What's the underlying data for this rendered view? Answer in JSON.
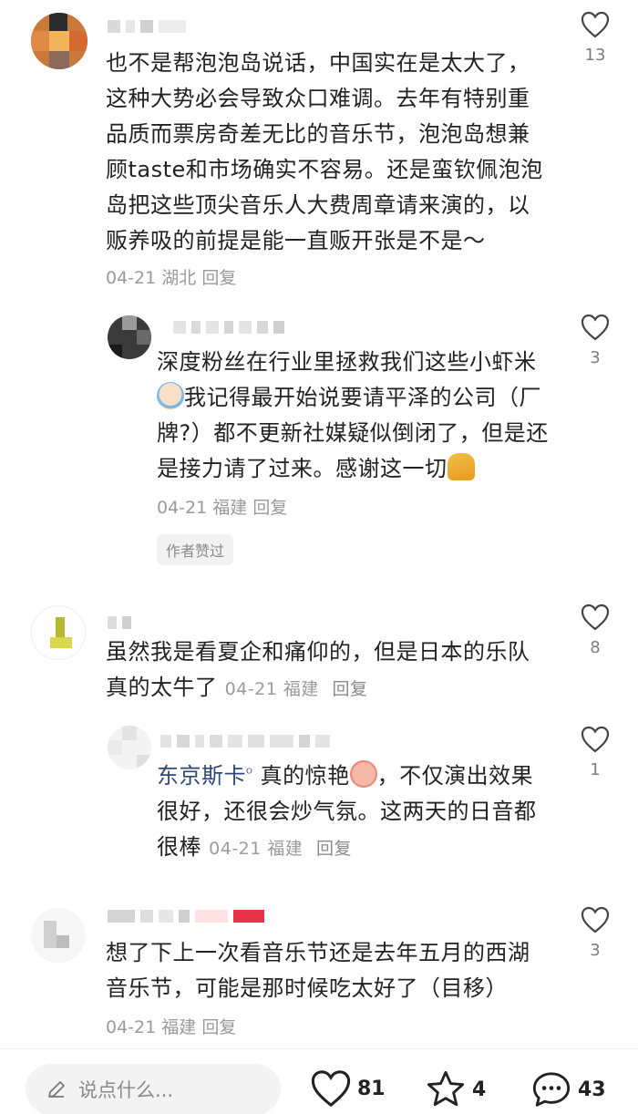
{
  "comments": [
    {
      "content": "也不是帮泡泡岛说话，中国实在是太大了，这种大势必会导致众口难调。去年有特别重品质而票房奇差无比的音乐节，泡泡岛想兼顾taste和市场确实不容易。还是蛮钦佩泡泡岛把这些顶尖音乐人大费周章请来演的，以贩养吸的前提是能一直贩开张是不是～",
      "lines": [
        "也不是帮泡泡岛说话，中国实在是太大了，",
        "这种大势必会导致众口难调。去年有特别重",
        "品质而票房奇差无比的音乐节，泡泡岛想兼",
        "顾taste和市场确实不容易。还是蛮钦佩泡泡",
        "岛把这些顶尖音乐人大费周章请来演的，以",
        "贩养吸的前提是能一直贩开张是不是～"
      ],
      "date": "04-21",
      "location": "湖北",
      "reply_label": "回复",
      "likes": "13"
    },
    {
      "lines": [
        "深度粉丝在行业里拯救我们这些小虾米",
        "我记得最开始说要请平泽的公司（厂",
        "牌?）都不更新社媒疑似倒闭了，但是还",
        "是接力请了过来。感谢这一切"
      ],
      "date": "04-21",
      "location": "福建",
      "reply_label": "回复",
      "badge": "作者赞过",
      "likes": "3"
    },
    {
      "lines": [
        "虽然我是看夏企和痛仰的，但是日本的乐队",
        "真的太牛了"
      ],
      "date": "04-21",
      "location": "福建",
      "reply_label": "回复",
      "likes": "8"
    },
    {
      "mention": "东京斯卡",
      "mention_mark": "ᴼ",
      "lines": [
        "真的惊艳",
        "，不仅演出效果",
        "很好，还很会炒气氛。这两天的日音都",
        "很棒"
      ],
      "date": "04-21",
      "location": "福建",
      "reply_label": "回复",
      "likes": "1"
    },
    {
      "lines": [
        "想了下上一次看音乐节还是去年五月的西湖",
        "音乐节，可能是那时候吃太好了（目移）"
      ],
      "date": "04-21",
      "location": "福建",
      "reply_label": "回复",
      "likes": "3"
    }
  ],
  "bottom_bar": {
    "input_placeholder": "说点什么...",
    "like_count": "81",
    "star_count": "4",
    "comment_count": "43"
  },
  "colors": {
    "text": "#222222",
    "meta": "#9a9a9a",
    "mention": "#2f4a7a",
    "badge_bg": "#f2f2f2"
  },
  "icons": [
    "heart-icon",
    "star-icon",
    "chat-bubble-icon",
    "pencil-icon",
    "emoji-sweat-icon",
    "emoji-pray-icon"
  ]
}
